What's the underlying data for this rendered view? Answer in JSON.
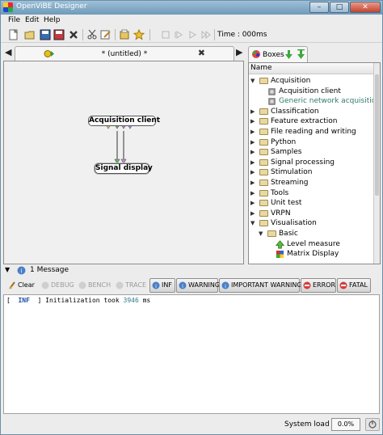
{
  "window": {
    "title": "OpenViBE Designer",
    "min_label": "–",
    "max_label": "□",
    "close_label": "✕"
  },
  "menu": {
    "file": "File",
    "edit": "Edit",
    "help": "Help"
  },
  "toolbar": {
    "time_label": "Time : 000ms"
  },
  "designer": {
    "tab_title": "* (untitled) *",
    "scroll_left": "◀",
    "scroll_right": "▶",
    "close": "✖",
    "boxes": [
      {
        "label": "Acquisition client"
      },
      {
        "label": "Signal display"
      }
    ]
  },
  "boxes_panel": {
    "tab_label": "Boxes",
    "tree_header": "Name",
    "tree": [
      {
        "label": "Acquisition",
        "level": 0,
        "expanded": true,
        "kind": "folder"
      },
      {
        "label": "Acquisition client",
        "level": 1,
        "kind": "box"
      },
      {
        "label": "Generic network acquisition",
        "level": 1,
        "kind": "box",
        "deprecated": true
      },
      {
        "label": "Classification",
        "level": 0,
        "expanded": false,
        "kind": "folder"
      },
      {
        "label": "Feature extraction",
        "level": 0,
        "expanded": false,
        "kind": "folder"
      },
      {
        "label": "File reading and writing",
        "level": 0,
        "expanded": false,
        "kind": "folder"
      },
      {
        "label": "Python",
        "level": 0,
        "expanded": false,
        "kind": "folder"
      },
      {
        "label": "Samples",
        "level": 0,
        "expanded": false,
        "kind": "folder"
      },
      {
        "label": "Signal processing",
        "level": 0,
        "expanded": false,
        "kind": "folder"
      },
      {
        "label": "Stimulation",
        "level": 0,
        "expanded": false,
        "kind": "folder"
      },
      {
        "label": "Streaming",
        "level": 0,
        "expanded": false,
        "kind": "folder"
      },
      {
        "label": "Tools",
        "level": 0,
        "expanded": false,
        "kind": "folder"
      },
      {
        "label": "Unit test",
        "level": 0,
        "expanded": false,
        "kind": "folder"
      },
      {
        "label": "VRPN",
        "level": 0,
        "expanded": false,
        "kind": "folder"
      },
      {
        "label": "Visualisation",
        "level": 0,
        "expanded": true,
        "kind": "folder"
      },
      {
        "label": "Basic",
        "level": 1,
        "expanded": true,
        "kind": "folder"
      },
      {
        "label": "Level measure",
        "level": 2,
        "kind": "box"
      },
      {
        "label": "Matrix Display",
        "level": 2,
        "kind": "box"
      }
    ]
  },
  "messages": {
    "header": "1 Message",
    "buttons": {
      "clear": "Clear",
      "debug": "DEBUG",
      "bench": "BENCH",
      "trace": "TRACE",
      "inf": "INF",
      "warning": "WARNING",
      "important_warning": "IMPORTANT WARNING",
      "error": "ERROR",
      "fatal": "FATAL"
    },
    "log": [
      {
        "prefix": "[  ",
        "level": "INF",
        "mid": "  ] Initialization took ",
        "value": "3946",
        "suffix": " ms"
      }
    ]
  },
  "status": {
    "label": "System load :",
    "value": "0.0%"
  },
  "colors": {
    "accent_blue": "#2a6fb5",
    "log_level": "#1c4fa0",
    "log_value": "#2f7a8a",
    "deprecated": "#2f7a6a"
  }
}
